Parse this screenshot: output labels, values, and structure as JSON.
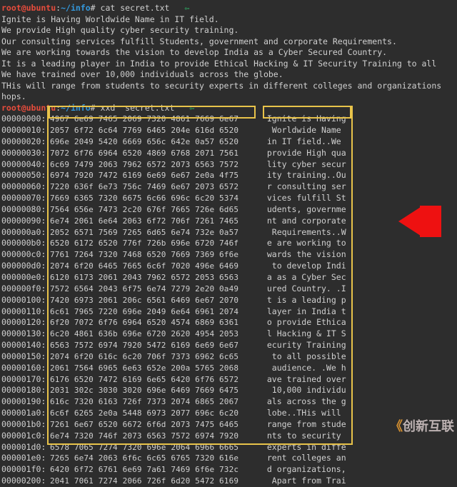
{
  "prompt1": {
    "user": "root@ubuntu",
    "path": "~/info",
    "hash": "#",
    "cmd": "cat secret.txt"
  },
  "catlines": [
    "Ignite is Having Worldwide Name in IT field.",
    "We provide High quality cyber security training.",
    "Our consulting services fulfill Students, government and corporate Requirements.",
    "We are working towards the vision to develop India as a Cyber Secured Country.",
    "It is a leading player in India to provide Ethical Hacking & IT Security Training to all",
    "We have trained over 10,000 individuals across the globe.",
    "THis will range from students to security experts in different colleges and organizations",
    "hops."
  ],
  "prompt2": {
    "user": "root@ubuntu",
    "path": "~/info",
    "hash": "#",
    "cmd": "xxd  secret.txt"
  },
  "xxd": [
    {
      "off": "00000000:",
      "hex": "4967 6e69 7465 2069 7320 4861 7669 6e67",
      "asc": "Ignite is Having"
    },
    {
      "off": "00000010:",
      "hex": "2057 6f72 6c64 7769 6465 204e 616d 6520",
      "asc": " Worldwide Name "
    },
    {
      "off": "00000020:",
      "hex": "696e 2049 5420 6669 656c 642e 0a57 6520",
      "asc": "in IT field..We "
    },
    {
      "off": "00000030:",
      "hex": "7072 6f76 6964 6520 4869 6768 2071 7561",
      "asc": "provide High qua"
    },
    {
      "off": "00000040:",
      "hex": "6c69 7479 2063 7962 6572 2073 6563 7572",
      "asc": "lity cyber secur"
    },
    {
      "off": "00000050:",
      "hex": "6974 7920 7472 6169 6e69 6e67 2e0a 4f75",
      "asc": "ity training..Ou"
    },
    {
      "off": "00000060:",
      "hex": "7220 636f 6e73 756c 7469 6e67 2073 6572",
      "asc": "r consulting ser"
    },
    {
      "off": "00000070:",
      "hex": "7669 6365 7320 6675 6c66 696c 6c20 5374",
      "asc": "vices fulfill St"
    },
    {
      "off": "00000080:",
      "hex": "7564 656e 7473 2c20 676f 7665 726e 6d65",
      "asc": "udents, governme"
    },
    {
      "off": "00000090:",
      "hex": "6e74 2061 6e64 2063 6f72 706f 7261 7465",
      "asc": "nt and corporate"
    },
    {
      "off": "000000a0:",
      "hex": "2052 6571 7569 7265 6d65 6e74 732e 0a57",
      "asc": " Requirements..W"
    },
    {
      "off": "000000b0:",
      "hex": "6520 6172 6520 776f 726b 696e 6720 746f",
      "asc": "e are working to"
    },
    {
      "off": "000000c0:",
      "hex": "7761 7264 7320 7468 6520 7669 7369 6f6e",
      "asc": "wards the vision"
    },
    {
      "off": "000000d0:",
      "hex": "2074 6f20 6465 7665 6c6f 7020 496e 6469",
      "asc": " to develop Indi"
    },
    {
      "off": "000000e0:",
      "hex": "6120 6173 2061 2043 7962 6572 2053 6563",
      "asc": "a as a Cyber Sec"
    },
    {
      "off": "000000f0:",
      "hex": "7572 6564 2043 6f75 6e74 7279 2e20 0a49",
      "asc": "ured Country. .I"
    },
    {
      "off": "00000100:",
      "hex": "7420 6973 2061 206c 6561 6469 6e67 2070",
      "asc": "t is a leading p"
    },
    {
      "off": "00000110:",
      "hex": "6c61 7965 7220 696e 2049 6e64 6961 2074",
      "asc": "layer in India t"
    },
    {
      "off": "00000120:",
      "hex": "6f20 7072 6f76 6964 6520 4574 6869 6361",
      "asc": "o provide Ethica"
    },
    {
      "off": "00000130:",
      "hex": "6c20 4861 636b 696e 6720 2620 4954 2053",
      "asc": "l Hacking & IT S"
    },
    {
      "off": "00000140:",
      "hex": "6563 7572 6974 7920 5472 6169 6e69 6e67",
      "asc": "ecurity Training"
    },
    {
      "off": "00000150:",
      "hex": "2074 6f20 616c 6c20 706f 7373 6962 6c65",
      "asc": " to all possible"
    },
    {
      "off": "00000160:",
      "hex": "2061 7564 6965 6e63 652e 200a 5765 2068",
      "asc": " audience. .We h"
    },
    {
      "off": "00000170:",
      "hex": "6176 6520 7472 6169 6e65 6420 6f76 6572",
      "asc": "ave trained over"
    },
    {
      "off": "00000180:",
      "hex": "2031 302c 3030 3020 696e 6469 7669 6475",
      "asc": " 10,000 individu"
    },
    {
      "off": "00000190:",
      "hex": "616c 7320 6163 726f 7373 2074 6865 2067",
      "asc": "als across the g"
    },
    {
      "off": "000001a0:",
      "hex": "6c6f 6265 2e0a 5448 6973 2077 696c 6c20",
      "asc": "lobe..THis will "
    },
    {
      "off": "000001b0:",
      "hex": "7261 6e67 6520 6672 6f6d 2073 7475 6465",
      "asc": "range from stude"
    },
    {
      "off": "000001c0:",
      "hex": "6e74 7320 746f 2073 6563 7572 6974 7920",
      "asc": "nts to security "
    },
    {
      "off": "000001d0:",
      "hex": "6578 7065 7274 7320 696e 2064 6966 6665",
      "asc": "experts in diffe"
    },
    {
      "off": "000001e0:",
      "hex": "7265 6e74 2063 6f6c 6c65 6765 7320 616e",
      "asc": "rent colleges an"
    },
    {
      "off": "000001f0:",
      "hex": "6420 6f72 6761 6e69 7a61 7469 6f6e 732c",
      "asc": "d organizations,"
    },
    {
      "off": "00000200:",
      "hex": "2041 7061 7274 2066 726f 6d20 5472 6169",
      "asc": " Apart from Trai"
    }
  ],
  "watermark": {
    "text": "创新互联",
    "suffix": ""
  }
}
